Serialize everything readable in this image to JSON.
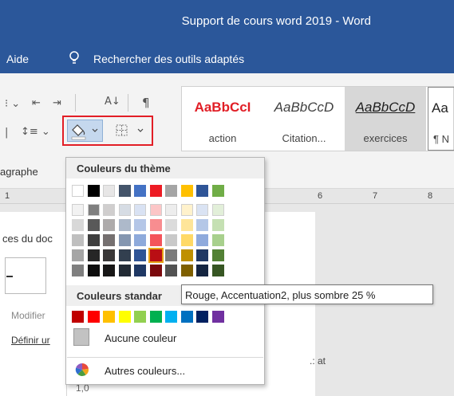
{
  "window": {
    "title": "Support de cours word 2019  -  Word"
  },
  "menu": {
    "aide": "Aide",
    "search": "Rechercher des outils adaptés"
  },
  "ribbon": {
    "group_label": "agraphe",
    "styles": [
      {
        "sample": "AaBbCcI",
        "name": "action"
      },
      {
        "sample": "AaBbCcD",
        "name": "Citation..."
      },
      {
        "sample": "AaBbCcD",
        "name": "exercices"
      },
      {
        "sample": "Aa",
        "name": "¶ N"
      }
    ]
  },
  "ruler": {
    "numbers": [
      "1",
      "6",
      "7",
      "8"
    ]
  },
  "document": {
    "nav_heading": "ces du doc",
    "modifier": "Modifier",
    "definir": "Définir ur",
    "at_text": ".: at",
    "number": "1,0"
  },
  "dropdown": {
    "theme_header": "Couleurs du thème",
    "standard_header": "Couleurs standar",
    "no_color": "Aucune couleur",
    "more_colors": "Autres couleurs...",
    "theme_top_row": [
      "#ffffff",
      "#000000",
      "#e7e6e6",
      "#44546a",
      "#4472c4",
      "#ed1c24",
      "#a5a5a5",
      "#ffc000",
      "#2f5597",
      "#70ad47"
    ],
    "theme_shades": [
      [
        "#f2f2f2",
        "#7f7f7f",
        "#d0cece",
        "#d6dce4",
        "#d9e2f3",
        "#fcc6c7",
        "#ededed",
        "#fff2cc",
        "#dae3f3",
        "#e2efd9"
      ],
      [
        "#d8d8d8",
        "#595959",
        "#aeabab",
        "#adb9ca",
        "#b4c6e7",
        "#f88d90",
        "#dbdbdb",
        "#fee599",
        "#b4c7e7",
        "#c5e0b3"
      ],
      [
        "#bfbfbf",
        "#3f3f3f",
        "#757070",
        "#8496b0",
        "#8eaadb",
        "#f4545a",
        "#c9c9c9",
        "#ffd966",
        "#8faadc",
        "#a8d08d"
      ],
      [
        "#a5a5a5",
        "#262626",
        "#3a3838",
        "#323f4f",
        "#2f5496",
        "#b90e14",
        "#7b7b7b",
        "#bf9000",
        "#203864",
        "#538135"
      ],
      [
        "#7f7f7f",
        "#0d0d0d",
        "#171616",
        "#222a35",
        "#1f3864",
        "#7b090d",
        "#525252",
        "#7f6000",
        "#152541",
        "#375623"
      ]
    ],
    "standard_colors": [
      "#c00000",
      "#ff0000",
      "#ffc000",
      "#ffff00",
      "#92d050",
      "#00b050",
      "#00b0f0",
      "#0070c0",
      "#002060",
      "#7030a0"
    ],
    "selected_color": "#7b090d"
  },
  "tooltip": {
    "text": "Rouge, Accentuation2, plus sombre 25 %"
  }
}
